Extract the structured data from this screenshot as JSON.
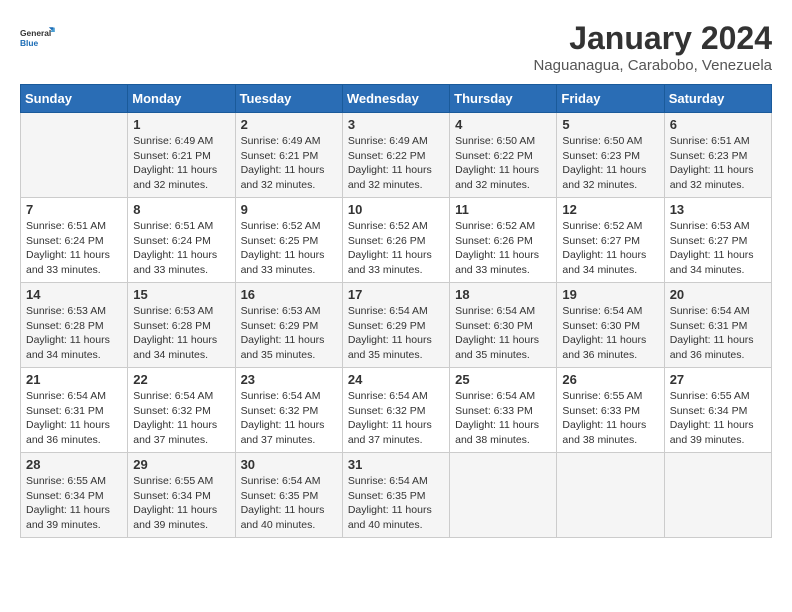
{
  "header": {
    "logo_line1": "General",
    "logo_line2": "Blue",
    "calendar_title": "January 2024",
    "calendar_subtitle": "Naguanagua, Carabobo, Venezuela"
  },
  "days_of_week": [
    "Sunday",
    "Monday",
    "Tuesday",
    "Wednesday",
    "Thursday",
    "Friday",
    "Saturday"
  ],
  "weeks": [
    [
      {
        "day": "",
        "sunrise": "",
        "sunset": "",
        "daylight": ""
      },
      {
        "day": "1",
        "sunrise": "Sunrise: 6:49 AM",
        "sunset": "Sunset: 6:21 PM",
        "daylight": "Daylight: 11 hours and 32 minutes."
      },
      {
        "day": "2",
        "sunrise": "Sunrise: 6:49 AM",
        "sunset": "Sunset: 6:21 PM",
        "daylight": "Daylight: 11 hours and 32 minutes."
      },
      {
        "day": "3",
        "sunrise": "Sunrise: 6:49 AM",
        "sunset": "Sunset: 6:22 PM",
        "daylight": "Daylight: 11 hours and 32 minutes."
      },
      {
        "day": "4",
        "sunrise": "Sunrise: 6:50 AM",
        "sunset": "Sunset: 6:22 PM",
        "daylight": "Daylight: 11 hours and 32 minutes."
      },
      {
        "day": "5",
        "sunrise": "Sunrise: 6:50 AM",
        "sunset": "Sunset: 6:23 PM",
        "daylight": "Daylight: 11 hours and 32 minutes."
      },
      {
        "day": "6",
        "sunrise": "Sunrise: 6:51 AM",
        "sunset": "Sunset: 6:23 PM",
        "daylight": "Daylight: 11 hours and 32 minutes."
      }
    ],
    [
      {
        "day": "7",
        "sunrise": "Sunrise: 6:51 AM",
        "sunset": "Sunset: 6:24 PM",
        "daylight": "Daylight: 11 hours and 33 minutes."
      },
      {
        "day": "8",
        "sunrise": "Sunrise: 6:51 AM",
        "sunset": "Sunset: 6:24 PM",
        "daylight": "Daylight: 11 hours and 33 minutes."
      },
      {
        "day": "9",
        "sunrise": "Sunrise: 6:52 AM",
        "sunset": "Sunset: 6:25 PM",
        "daylight": "Daylight: 11 hours and 33 minutes."
      },
      {
        "day": "10",
        "sunrise": "Sunrise: 6:52 AM",
        "sunset": "Sunset: 6:26 PM",
        "daylight": "Daylight: 11 hours and 33 minutes."
      },
      {
        "day": "11",
        "sunrise": "Sunrise: 6:52 AM",
        "sunset": "Sunset: 6:26 PM",
        "daylight": "Daylight: 11 hours and 33 minutes."
      },
      {
        "day": "12",
        "sunrise": "Sunrise: 6:52 AM",
        "sunset": "Sunset: 6:27 PM",
        "daylight": "Daylight: 11 hours and 34 minutes."
      },
      {
        "day": "13",
        "sunrise": "Sunrise: 6:53 AM",
        "sunset": "Sunset: 6:27 PM",
        "daylight": "Daylight: 11 hours and 34 minutes."
      }
    ],
    [
      {
        "day": "14",
        "sunrise": "Sunrise: 6:53 AM",
        "sunset": "Sunset: 6:28 PM",
        "daylight": "Daylight: 11 hours and 34 minutes."
      },
      {
        "day": "15",
        "sunrise": "Sunrise: 6:53 AM",
        "sunset": "Sunset: 6:28 PM",
        "daylight": "Daylight: 11 hours and 34 minutes."
      },
      {
        "day": "16",
        "sunrise": "Sunrise: 6:53 AM",
        "sunset": "Sunset: 6:29 PM",
        "daylight": "Daylight: 11 hours and 35 minutes."
      },
      {
        "day": "17",
        "sunrise": "Sunrise: 6:54 AM",
        "sunset": "Sunset: 6:29 PM",
        "daylight": "Daylight: 11 hours and 35 minutes."
      },
      {
        "day": "18",
        "sunrise": "Sunrise: 6:54 AM",
        "sunset": "Sunset: 6:30 PM",
        "daylight": "Daylight: 11 hours and 35 minutes."
      },
      {
        "day": "19",
        "sunrise": "Sunrise: 6:54 AM",
        "sunset": "Sunset: 6:30 PM",
        "daylight": "Daylight: 11 hours and 36 minutes."
      },
      {
        "day": "20",
        "sunrise": "Sunrise: 6:54 AM",
        "sunset": "Sunset: 6:31 PM",
        "daylight": "Daylight: 11 hours and 36 minutes."
      }
    ],
    [
      {
        "day": "21",
        "sunrise": "Sunrise: 6:54 AM",
        "sunset": "Sunset: 6:31 PM",
        "daylight": "Daylight: 11 hours and 36 minutes."
      },
      {
        "day": "22",
        "sunrise": "Sunrise: 6:54 AM",
        "sunset": "Sunset: 6:32 PM",
        "daylight": "Daylight: 11 hours and 37 minutes."
      },
      {
        "day": "23",
        "sunrise": "Sunrise: 6:54 AM",
        "sunset": "Sunset: 6:32 PM",
        "daylight": "Daylight: 11 hours and 37 minutes."
      },
      {
        "day": "24",
        "sunrise": "Sunrise: 6:54 AM",
        "sunset": "Sunset: 6:32 PM",
        "daylight": "Daylight: 11 hours and 37 minutes."
      },
      {
        "day": "25",
        "sunrise": "Sunrise: 6:54 AM",
        "sunset": "Sunset: 6:33 PM",
        "daylight": "Daylight: 11 hours and 38 minutes."
      },
      {
        "day": "26",
        "sunrise": "Sunrise: 6:55 AM",
        "sunset": "Sunset: 6:33 PM",
        "daylight": "Daylight: 11 hours and 38 minutes."
      },
      {
        "day": "27",
        "sunrise": "Sunrise: 6:55 AM",
        "sunset": "Sunset: 6:34 PM",
        "daylight": "Daylight: 11 hours and 39 minutes."
      }
    ],
    [
      {
        "day": "28",
        "sunrise": "Sunrise: 6:55 AM",
        "sunset": "Sunset: 6:34 PM",
        "daylight": "Daylight: 11 hours and 39 minutes."
      },
      {
        "day": "29",
        "sunrise": "Sunrise: 6:55 AM",
        "sunset": "Sunset: 6:34 PM",
        "daylight": "Daylight: 11 hours and 39 minutes."
      },
      {
        "day": "30",
        "sunrise": "Sunrise: 6:54 AM",
        "sunset": "Sunset: 6:35 PM",
        "daylight": "Daylight: 11 hours and 40 minutes."
      },
      {
        "day": "31",
        "sunrise": "Sunrise: 6:54 AM",
        "sunset": "Sunset: 6:35 PM",
        "daylight": "Daylight: 11 hours and 40 minutes."
      },
      {
        "day": "",
        "sunrise": "",
        "sunset": "",
        "daylight": ""
      },
      {
        "day": "",
        "sunrise": "",
        "sunset": "",
        "daylight": ""
      },
      {
        "day": "",
        "sunrise": "",
        "sunset": "",
        "daylight": ""
      }
    ]
  ]
}
